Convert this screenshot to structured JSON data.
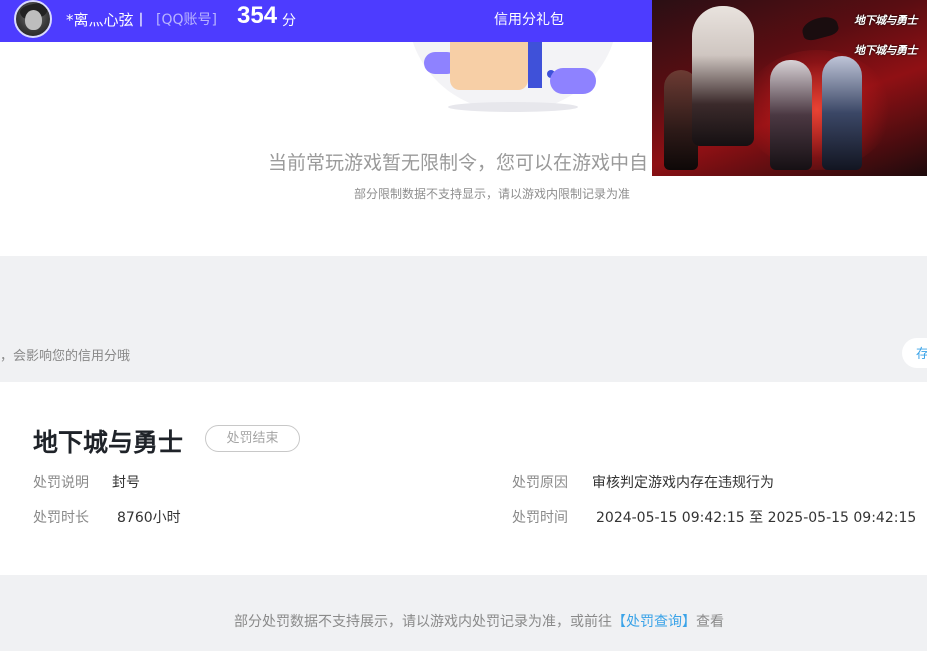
{
  "header": {
    "username": "*离灬心弦丨",
    "account_type": "[QQ账号]",
    "score": "354",
    "score_unit": "分",
    "gift_link": "信用分礼包"
  },
  "empty_state": {
    "title": "当前常玩游戏暂无限制令，您可以在游戏中自",
    "subtitle": "部分限制数据不支持显示，请以游戏内限制记录为准"
  },
  "banner": {
    "logo_text_1": "地下城与勇士",
    "logo_text_2": "地下城与勇士"
  },
  "notice": {
    "text": "，会影响您的信用分哦",
    "pill_label": "存"
  },
  "penalty": {
    "game_name": "地下城与勇士",
    "status": "处罚结束",
    "desc_label": "处罚说明",
    "desc_value": "封号",
    "duration_label": "处罚时长",
    "duration_value": "8760小时",
    "reason_label": "处罚原因",
    "reason_value": "审核判定游戏内存在违规行为",
    "time_label": "处罚时间",
    "time_value": "2024-05-15 09:42:15 至 2025-05-15 09:42:15"
  },
  "footer": {
    "text_before": "部分处罚数据不支持展示，请以游戏内处罚记录为准，或前往",
    "link_text": "【处罚查询】",
    "text_after": "查看"
  },
  "colors": {
    "topbar": "#4d3cff",
    "band": "#f0f1f3",
    "link": "#3aa3e8"
  }
}
